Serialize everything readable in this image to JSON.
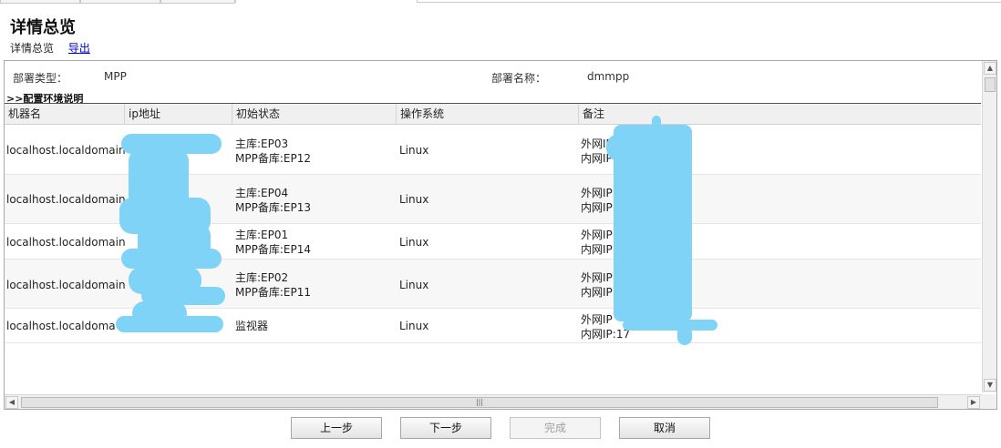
{
  "page": {
    "title": "详情总览",
    "breadcrumb_current": "详情总览",
    "export_link": "导出"
  },
  "deploy": {
    "type_label": "部署类型：",
    "type_value": "MPP",
    "name_label": "部署名称：",
    "name_value": "dmmpp"
  },
  "section": {
    "title": ">>配置环境说明"
  },
  "table": {
    "headers": [
      "机器名",
      "ip地址",
      "初始状态",
      "操作系统",
      "备注"
    ],
    "rows": [
      {
        "host": "localhost.localdomain",
        "ip": "",
        "state1": "主库:EP03",
        "state2": "MPP备库:EP12",
        "os": "Linux",
        "note1": "外网IP",
        "note2": "内网IP"
      },
      {
        "host": "localhost.localdomain",
        "ip": "",
        "state1": "主库:EP04",
        "state2": "MPP备库:EP13",
        "os": "Linux",
        "note1": "外网IP",
        "note2": "内网IP"
      },
      {
        "host": "localhost.localdomain",
        "ip": "",
        "state1": "主库:EP01",
        "state2": "MPP备库:EP14",
        "os": "Linux",
        "note1": "外网IP",
        "note2": "内网IP"
      },
      {
        "host": "localhost.localdomain",
        "ip": "",
        "state1": "主库:EP02",
        "state2": "MPP备库:EP11",
        "os": "Linux",
        "note1": "外网IP",
        "note2": "内网IP"
      },
      {
        "host": "localhost.localdoma",
        "ip": "",
        "state1": "监视器",
        "state2": "",
        "os": "Linux",
        "note1": "外网IP",
        "note2": "内网IP:17"
      }
    ]
  },
  "buttons": {
    "prev": "上一步",
    "next": "下一步",
    "finish": "完成",
    "cancel": "取消"
  },
  "icons": {
    "scroll_up": "triangle-up",
    "scroll_down": "triangle-down",
    "scroll_left": "triangle-left",
    "scroll_right": "triangle-right",
    "grip": "grip-lines"
  },
  "colors": {
    "link": "#0000cc",
    "redaction": "#7fd3f7",
    "disabled_text": "#a0a0a0"
  }
}
